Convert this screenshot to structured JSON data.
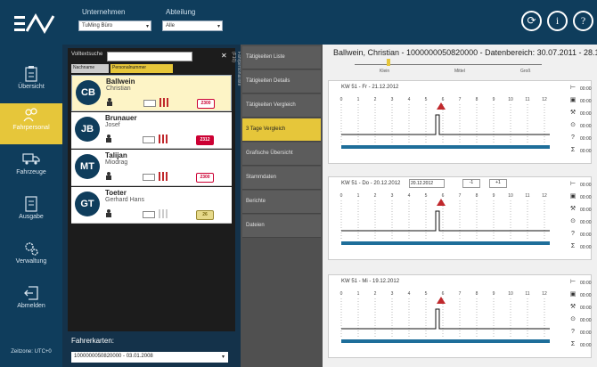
{
  "header": {
    "company_label": "Unternehmen",
    "company_value": "TuMing Büro",
    "department_label": "Abteilung",
    "department_value": "Alle",
    "icons": [
      "sync-icon",
      "info-icon",
      "help-icon"
    ]
  },
  "sidebar": {
    "items": [
      {
        "label": "Übersicht",
        "icon": "clipboard-icon"
      },
      {
        "label": "Fahrpersonal",
        "icon": "people-icon",
        "active": true
      },
      {
        "label": "Fahrzeuge",
        "icon": "truck-icon"
      },
      {
        "label": "Ausgabe",
        "icon": "document-icon"
      },
      {
        "label": "Verwaltung",
        "icon": "gears-icon"
      },
      {
        "label": "Abmelden",
        "icon": "logout-icon"
      }
    ],
    "status": "Zeitzone: UTC+0"
  },
  "driverlist": {
    "search_label": "Volltextsuche",
    "headers": {
      "name": "Nachname",
      "number": "Personalnummer"
    },
    "drivers": [
      {
        "initials": "CB",
        "last": "Ballwein",
        "first": "Christian",
        "badge": "2300",
        "selected": true
      },
      {
        "initials": "JB",
        "last": "Brunauer",
        "first": "Josef",
        "badge": "2312"
      },
      {
        "initials": "MT",
        "last": "Talijan",
        "first": "Miodrag",
        "badge": "2300"
      },
      {
        "initials": "GT",
        "last": "Toeter",
        "first": "Gerhard Hans",
        "badge": "26"
      }
    ],
    "fahrerkarten_label": "Fahrerkarten:",
    "fahrerkarten_value": "1000000050820000 - 03.01.2008"
  },
  "vertical_label": "Fahrpersonalliste (F10)",
  "tabs": [
    "Tätigkeiten Liste",
    "Tätigkeiten Details",
    "Tätigkeiten Vergleich",
    "3 Tage Vergleich",
    "Grafische Übersicht",
    "Stammdaten",
    "Berichte",
    "Dateien"
  ],
  "tab_active_index": 3,
  "detail": {
    "title": "Ballwein, Christian - 1000000050820000 - Datenbereich: 30.07.2011 - 28.12",
    "slider": [
      "Klein",
      "Mittel",
      "Groß"
    ],
    "days": [
      {
        "label": "KW 51 - Fr - 21.12.2012"
      },
      {
        "label": "KW 51 - Do - 20.12.2012",
        "input": "20.12.2012",
        "minus": "-1",
        "plus": "+1"
      },
      {
        "label": "KW 51 - Mi - 19.12.2012"
      }
    ],
    "hours": [
      "0",
      "1",
      "2",
      "3",
      "4",
      "5",
      "6",
      "7",
      "8",
      "9",
      "10",
      "11",
      "12"
    ],
    "legend": [
      "00:00",
      "00:00",
      "00:00",
      "00:00",
      "00:00",
      "00:00"
    ]
  }
}
